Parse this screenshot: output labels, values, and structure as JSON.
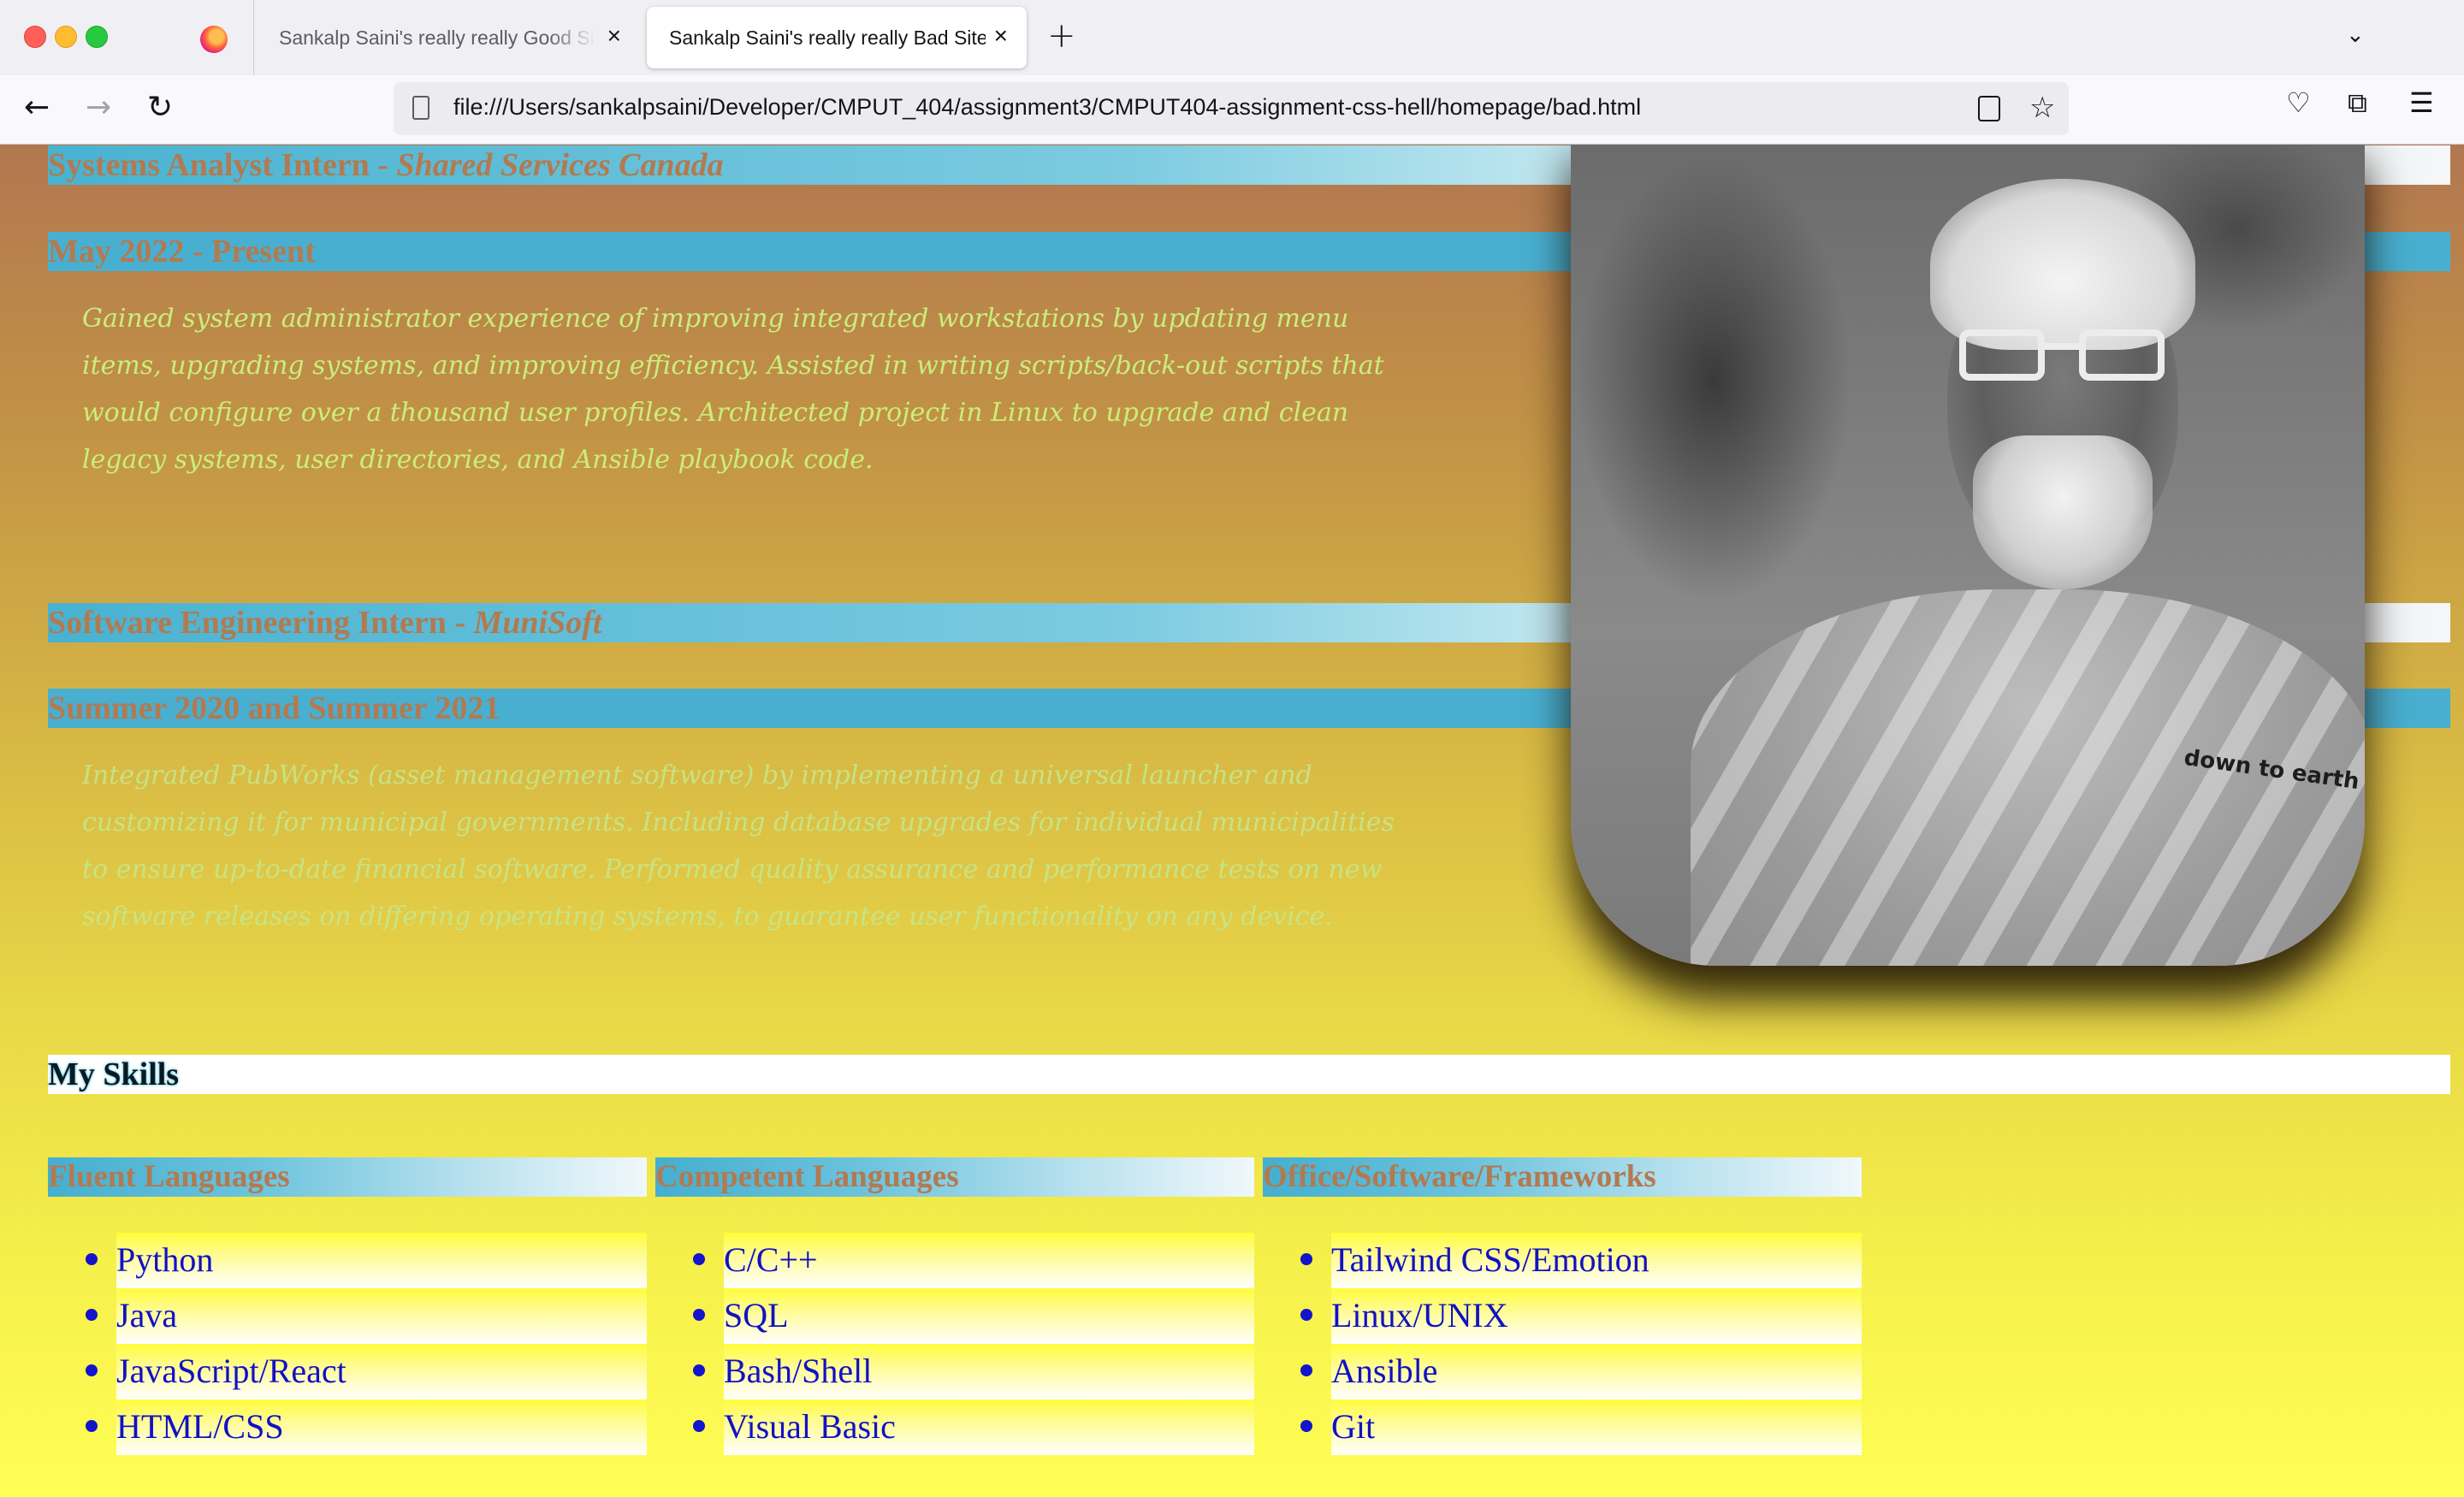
{
  "browser": {
    "tabs": [
      {
        "label": "Sankalp Saini's really really Good Site",
        "active": false
      },
      {
        "label": "Sankalp Saini's really really Bad Site",
        "active": true
      }
    ],
    "url": "file:///Users/sankalpsaini/Developer/CMPUT_404/assignment3/CMPUT404-assignment-css-hell/homepage/bad.html",
    "icons": [
      "back-icon",
      "forward-icon",
      "reload-icon",
      "page-icon",
      "reader-view-icon",
      "bookmark-star-icon",
      "pocket-icon",
      "extensions-icon",
      "menu-icon",
      "new-tab-icon",
      "tab-list-icon",
      "close-icon"
    ]
  },
  "experience": [
    {
      "role": "Systems Analyst Intern - ",
      "company": "Shared Services Canada",
      "dates": "May 2022 - Present",
      "description": "Gained system administrator experience of improving integrated workstations by updating menu items, upgrading systems, and improving efficiency. Assisted in writing scripts/back-out scripts that would configure over a thousand user profiles. Architected project in Linux to upgrade and clean legacy systems, user directories, and Ansible playbook code."
    },
    {
      "role": "Software Engineering Intern - ",
      "company": "MuniSoft",
      "dates": "Summer 2020 and Summer 2021",
      "description": "Integrated PubWorks (asset management software) by implementing a universal launcher and customizing it for municipal governments. Including database upgrades for individual municipalities to ensure up-to-date financial software. Performed quality assurance and performance tests on new software releases on differing operating systems, to guarantee user functionality on any device."
    }
  ],
  "photo": {
    "shirt_text": "down to earth"
  },
  "skills": {
    "heading": "My Skills",
    "columns": [
      {
        "title": "Fluent Languages",
        "items": [
          "Python",
          "Java",
          "JavaScript/React",
          "HTML/CSS"
        ]
      },
      {
        "title": "Competent Languages",
        "items": [
          "C/C++",
          "SQL",
          "Bash/Shell",
          "Visual Basic"
        ]
      },
      {
        "title": "Office/Software/Frameworks",
        "items": [
          "Tailwind CSS/Emotion",
          "Linux/UNIX",
          "Ansible",
          "Git"
        ]
      }
    ]
  },
  "colors": {
    "heading_text": "#b27a50",
    "heading_band": "#49afd0",
    "description_text": "#c9ee7a",
    "skill_text": "#1111c4",
    "background_top": "#b27750",
    "background_bottom": "#ffff55"
  }
}
